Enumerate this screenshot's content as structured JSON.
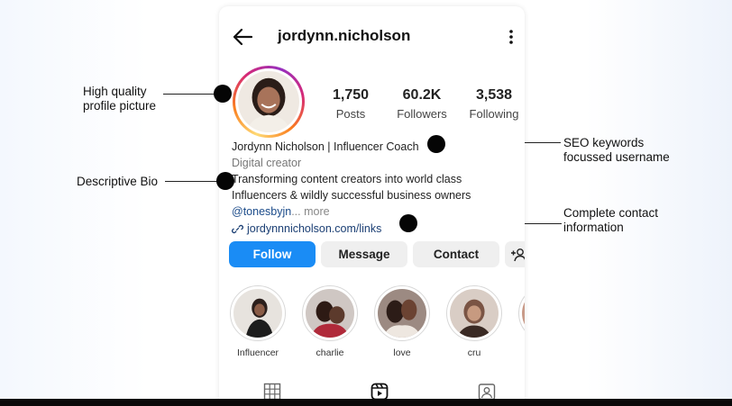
{
  "profile": {
    "username": "jordynn.nicholson",
    "stats": [
      {
        "value": "1,750",
        "label": "Posts"
      },
      {
        "value": "60.2K",
        "label": "Followers"
      },
      {
        "value": "3,538",
        "label": "Following"
      }
    ],
    "display_name": "Jordynn Nicholson | Influencer Coach",
    "category": "Digital creator",
    "bio_line1": "Transforming content creators into world class",
    "bio_line2": "Influencers & wildly successful business owners",
    "mention": "@tonesbyjn",
    "more": "... more",
    "link": "jordynnnicholson.com/links"
  },
  "buttons": {
    "follow": "Follow",
    "message": "Message",
    "contact": "Contact"
  },
  "highlights": [
    {
      "label": "Influencer"
    },
    {
      "label": "charlie"
    },
    {
      "label": "love"
    },
    {
      "label": "cru"
    }
  ],
  "annotations": {
    "profile_picture_1": "High quality",
    "profile_picture_2": "profile picture",
    "bio": "Descriptive Bio",
    "seo_1": "SEO keywords",
    "seo_2": "focussed username",
    "contact_1": "Complete contact",
    "contact_2": "information"
  },
  "colors": {
    "follow_button": "#1a8cf5",
    "link_text": "#1b3f74",
    "secondary_button": "#efefef"
  },
  "icons": [
    "back-arrow-icon",
    "more-options-icon",
    "link-icon",
    "add-person-icon",
    "grid-icon",
    "reels-icon",
    "tagged-icon"
  ]
}
